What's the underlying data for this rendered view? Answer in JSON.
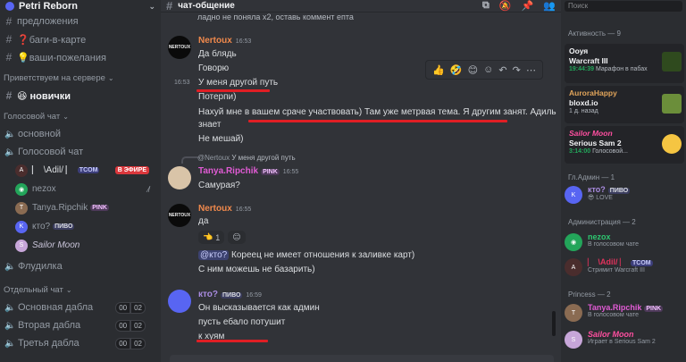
{
  "server": {
    "name": "Petri Reborn"
  },
  "sidebar": {
    "text_channels": [
      {
        "name": "предложения"
      },
      {
        "name": "❓баги-в-карте"
      },
      {
        "name": "💡ваши-пожелания"
      }
    ],
    "welcome_category": "Приветствуем на сервере",
    "welcome_channel": "😆 новички",
    "voice_category": "Голосовой чат",
    "voice_channels": [
      {
        "name": "основной"
      },
      {
        "name": "Голосовой чат"
      }
    ],
    "voice_users": [
      {
        "name": "⎸ \\Adil/ ⎸",
        "tag": "TCOM",
        "live": "В ЭФИРЕ"
      },
      {
        "name": "nezox"
      },
      {
        "name": "Tanya.Ripchik",
        "tag": "PINK"
      },
      {
        "name": "кто?",
        "tag": "ПИВО"
      },
      {
        "name": "Sailor Moon"
      }
    ],
    "voice_channel_extra": "Флудилка",
    "separate_category": "Отдельный чат",
    "separate_channels": [
      {
        "name": "Основная дабла",
        "users": "00",
        "limit": "02"
      },
      {
        "name": "Вторая дабла",
        "users": "00",
        "limit": "02"
      },
      {
        "name": "Третья дабла",
        "users": "00",
        "limit": "02"
      }
    ]
  },
  "chat": {
    "channel": "чат-общение",
    "top_line": "ладно не поняла х2, оставь коммент епта",
    "messages": [
      {
        "author": "Nertoux",
        "time": "16:53",
        "avatar": "NERTOUX",
        "lines": [
          "Да блядь",
          "Говорю",
          "У меня другой путь",
          "Потерпи)",
          "Нахуй мне в вашем сраче участвовать) Там уже метрвая тема. Я другим занят. Адиль",
          "знает",
          "Не мешай)"
        ],
        "stamp": "16:53"
      },
      {
        "reply_to_author": "@Nertoux",
        "reply_text": "У меня другой путь",
        "author": "Tanya.Ripchik",
        "tag": "PINK",
        "time": "16:55",
        "lines": [
          "Самурая?"
        ]
      },
      {
        "author": "Nertoux",
        "time": "16:55",
        "avatar": "NERTOUX",
        "lines": [
          "да",
          "@кто? Кореец не имеет отношения к заливке карт)",
          "С ним можешь не базарить)"
        ],
        "mention": "@кто?",
        "mention_rest": " Кореец не имеет отношения к заливке карт)",
        "reactions": [
          {
            "emoji": "👈",
            "count": "1"
          },
          {
            "emoji": "😑",
            "count": ""
          }
        ]
      },
      {
        "author": "кто?",
        "tag": "ПИВО",
        "time": "16:59",
        "lines": [
          "Он высказывается как админ",
          "пусть ебало потушит",
          "к хуям"
        ]
      }
    ]
  },
  "members": {
    "search_placeholder": "Поиск",
    "activity_header": "Активность — 9",
    "activities": [
      {
        "user": "Ооуя",
        "game": "Warcraft III",
        "status": "19:44:39",
        "detail": "Марафон в пабах"
      },
      {
        "user": "AuroraHappy",
        "game": "bloxd.io",
        "status": "1 д. назад",
        "detail": ""
      },
      {
        "user": "Sailor Moon",
        "game": "Serious Sam 2",
        "status": "3:14:00",
        "detail": "Голосовой..."
      }
    ],
    "groups": [
      {
        "header": "Гл.Админ — 1",
        "members": [
          {
            "name": "кто?",
            "tag": "ПИВО",
            "status": "😎 LOVE"
          }
        ]
      },
      {
        "header": "Администрация — 2",
        "members": [
          {
            "name": "nezox",
            "status": "В голосовом чате"
          },
          {
            "name": "⎸ \\Adil/ ⎸",
            "tag": "TCOM",
            "status": "Стримит Warcraft III"
          }
        ]
      },
      {
        "header": "Princess — 2",
        "members": [
          {
            "name": "Tanya.Ripchik",
            "tag": "PINK",
            "status": "В голосовом чате"
          },
          {
            "name": "Sailor Moon",
            "status": "Играет в Serious Sam 2"
          }
        ]
      }
    ]
  },
  "colors": {
    "accent": "#5865f2",
    "red_underline": "#e01e24",
    "online": "#23a55a",
    "nertoux": "#f0894c",
    "pink": "#e05bd4",
    "sailor": "#ff4fa0"
  }
}
